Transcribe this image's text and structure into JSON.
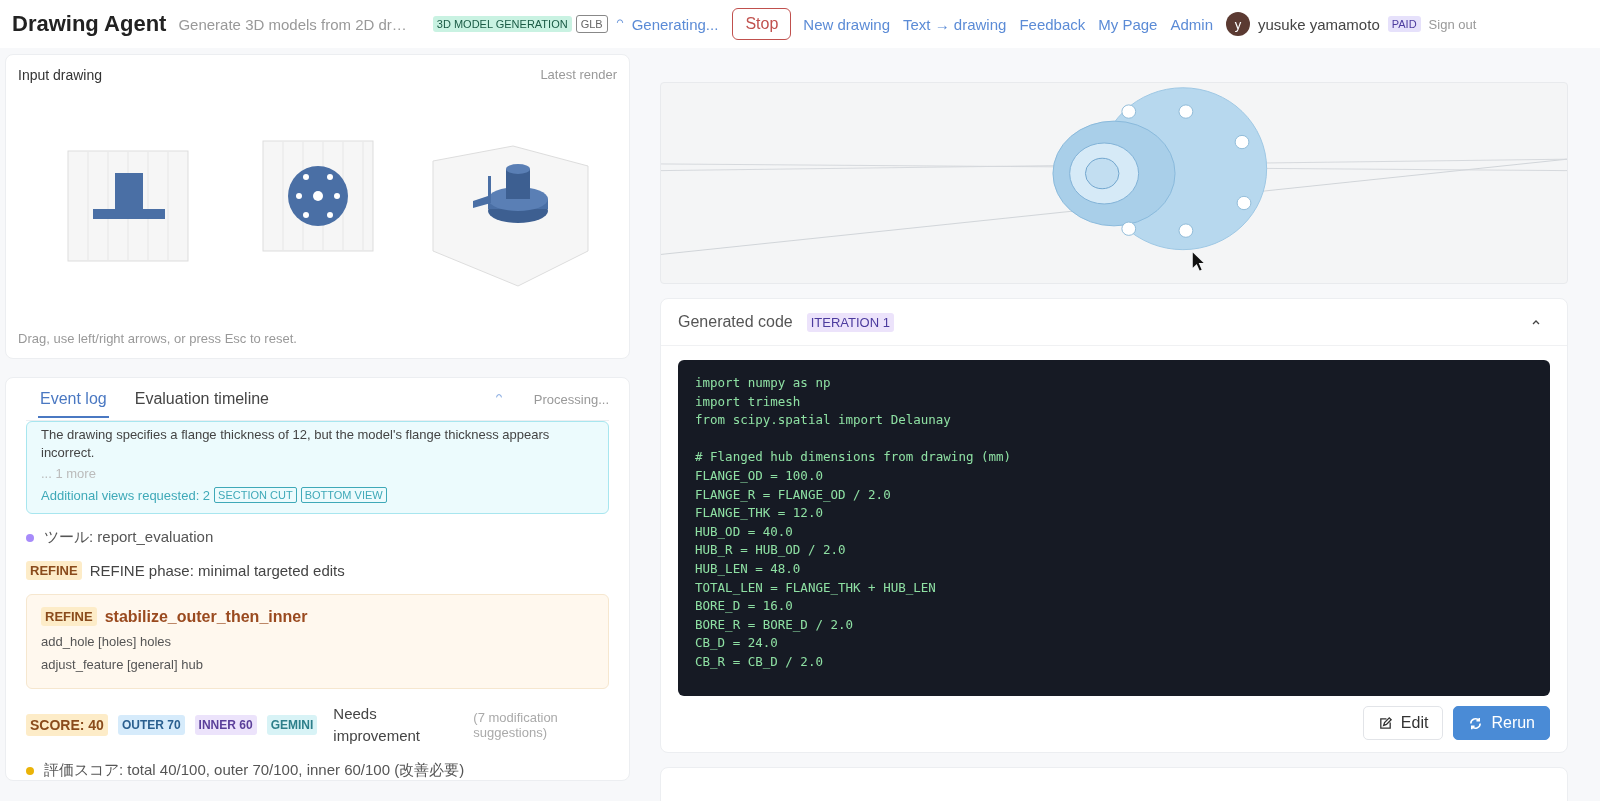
{
  "header": {
    "title": "Drawing Agent",
    "subtitle": "Generate 3D models from 2D dr…",
    "badges": [
      {
        "text": "3D MODEL GENERATION",
        "kind": "filled"
      },
      {
        "text": "GLB",
        "kind": "outline"
      }
    ],
    "status": "Generating...",
    "stop": "Stop",
    "links": [
      "New drawing",
      "Text → drawing",
      "Feedback",
      "My Page",
      "Admin"
    ],
    "user": {
      "initial": "y",
      "name": "yusuke yamamoto",
      "plan": "PAID"
    },
    "sign_out": "Sign out"
  },
  "input_panel": {
    "title": "Input drawing",
    "right_label": "Latest render",
    "hint": "Drag, use left/right arrows, or press Esc to reset."
  },
  "log_panel": {
    "tabs": [
      {
        "label": "Event log",
        "selected": true
      },
      {
        "label": "Evaluation timeline",
        "selected": false
      }
    ],
    "status": "Processing...",
    "events": [
      {
        "kind": "notice",
        "lines": [
          "The drawing specifies a flange thickness of 12, but the model's flange thickness appears incorrect."
        ],
        "more": "... 1 more",
        "views_label": "Additional views requested: 2",
        "view_tags": [
          "SECTION CUT",
          "BOTTOM VIEW"
        ]
      },
      {
        "kind": "tool",
        "color": "#a78bfa",
        "text": "ツール: report_evaluation"
      },
      {
        "kind": "phase",
        "tag": "REFINE",
        "text": "REFINE phase: minimal targeted edits"
      },
      {
        "kind": "plan",
        "tag": "REFINE",
        "title": "stabilize_outer_then_inner",
        "items": [
          "add_hole [holes] holes",
          "adjust_feature [general] hub"
        ]
      },
      {
        "kind": "score",
        "tags": [
          {
            "text": "SCORE: 40",
            "kind": "score"
          },
          {
            "text": "OUTER 70",
            "kind": "outer"
          },
          {
            "text": "INNER 60",
            "kind": "inner"
          },
          {
            "text": "GEMINI",
            "kind": "model"
          }
        ],
        "verdict": "Needs improvement",
        "note": "(7 modification suggestions)"
      },
      {
        "kind": "tool",
        "color": "#eab308",
        "text": "評価スコア: total 40/100, outer 70/100, inner 60/100 (改善必要)"
      }
    ]
  },
  "code_panel": {
    "title": "Generated code",
    "badge": "ITERATION 1",
    "blocks": [
      [
        "import numpy as np",
        "import trimesh",
        "from scipy.spatial import Delaunay"
      ],
      [
        "# Flanged hub dimensions from drawing (mm)",
        "FLANGE_OD = 100.0",
        "FLANGE_R = FLANGE_OD / 2.0",
        "FLANGE_THK = 12.0",
        "HUB_OD = 40.0",
        "HUB_R = HUB_OD / 2.0",
        "HUB_LEN = 48.0",
        "TOTAL_LEN = FLANGE_THK + HUB_LEN",
        "BORE_D = 16.0",
        "BORE_R = BORE_D / 2.0",
        "CB_D = 24.0",
        "CB_R = CB_D / 2.0"
      ]
    ],
    "buttons": [
      {
        "label": "Edit",
        "kind": "secondary"
      },
      {
        "label": "Rerun",
        "kind": "primary"
      }
    ]
  }
}
